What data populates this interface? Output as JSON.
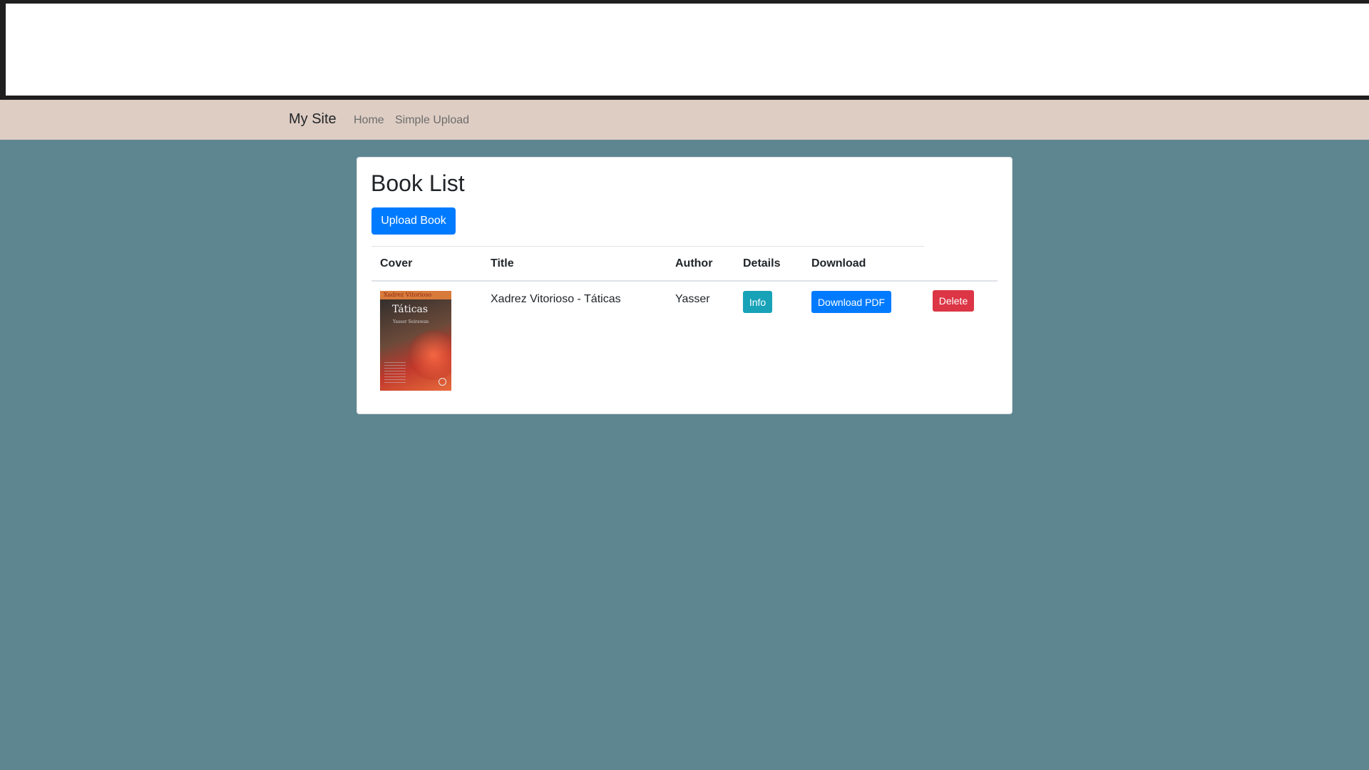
{
  "navbar": {
    "brand": "My Site",
    "links": [
      "Home",
      "Simple Upload"
    ]
  },
  "main": {
    "title": "Book List",
    "upload_button": "Upload Book",
    "table": {
      "columns": [
        "Cover",
        "Title",
        "Author",
        "Details",
        "Download"
      ],
      "rows": [
        {
          "cover": {
            "band_text": "Xadrez Vitorioso",
            "title": "Táticas",
            "author": "Yasser Seirawan"
          },
          "title": "Xadrez Vitorioso - Táticas",
          "author": "Yasser",
          "details_button": "Info",
          "download_button": "Download PDF",
          "delete_button": "Delete"
        }
      ]
    }
  },
  "colors": {
    "background": "#5e8690",
    "navbar": "#decdc3",
    "primary": "#007bff",
    "info": "#17a2b8",
    "danger": "#dc3545"
  }
}
